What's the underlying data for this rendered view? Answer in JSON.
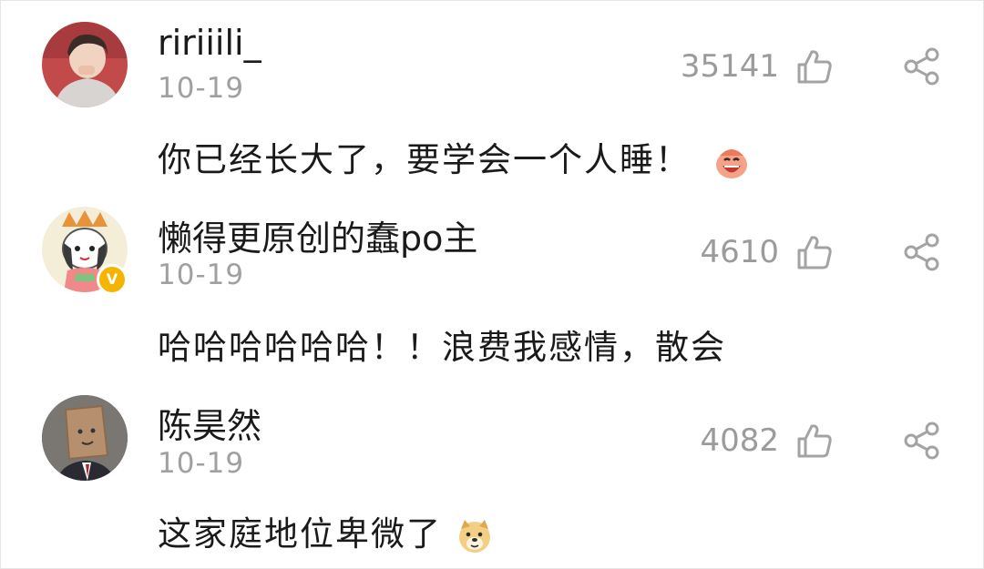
{
  "comments": [
    {
      "username": "ririiili_",
      "date": "10-19",
      "likes": "35141",
      "text": "你已经长大了，要学会一个人睡！",
      "emoji": "laughing-face-emoji",
      "verified": false
    },
    {
      "username": "懒得更原创的蠢po主",
      "date": "10-19",
      "likes": "4610",
      "text": "哈哈哈哈哈哈！！浪费我感情，散会",
      "emoji": null,
      "verified": true,
      "badge_label": "V"
    },
    {
      "username": "陈昊然",
      "date": "10-19",
      "likes": "4082",
      "text": "这家庭地位卑微了",
      "emoji": "doge-emoji",
      "verified": false
    }
  ],
  "icons": {
    "like": "thumbs-up-outline-icon",
    "share": "share-nodes-icon"
  },
  "colors": {
    "text": "#1a1a1a",
    "meta": "#a0a0a0",
    "badge": "#f4b400"
  }
}
